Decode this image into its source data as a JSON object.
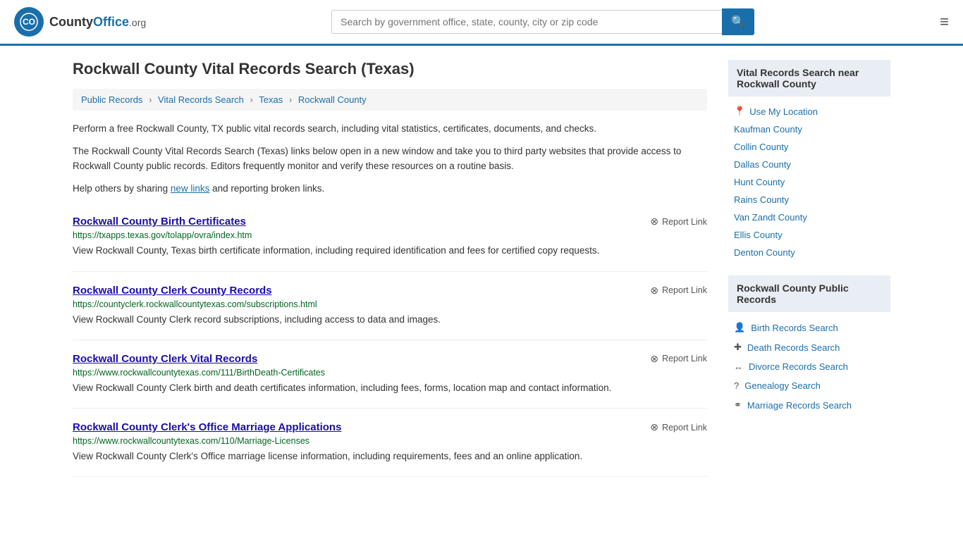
{
  "header": {
    "logo_text": "CountyOffice",
    "logo_org": ".org",
    "search_placeholder": "Search by government office, state, county, city or zip code"
  },
  "page": {
    "title": "Rockwall County Vital Records Search (Texas)"
  },
  "breadcrumb": {
    "items": [
      {
        "label": "Public Records",
        "url": "#"
      },
      {
        "label": "Vital Records Search",
        "url": "#"
      },
      {
        "label": "Texas",
        "url": "#"
      },
      {
        "label": "Rockwall County",
        "url": "#"
      }
    ]
  },
  "description": [
    {
      "text": "Perform a free Rockwall County, TX public vital records search, including vital statistics, certificates, documents, and checks."
    },
    {
      "text": "The Rockwall County Vital Records Search (Texas) links below open in a new window and take you to third party websites that provide access to Rockwall County public records. Editors frequently monitor and verify these resources on a routine basis."
    },
    {
      "text_parts": [
        "Help others by sharing ",
        "new links",
        " and reporting broken links."
      ]
    }
  ],
  "results": [
    {
      "title": "Rockwall County Birth Certificates",
      "url": "https://txapps.texas.gov/tolapp/ovra/index.htm",
      "desc": "View Rockwall County, Texas birth certificate information, including required identification and fees for certified copy requests.",
      "report_label": "Report Link"
    },
    {
      "title": "Rockwall County Clerk County Records",
      "url": "https://countyclerk.rockwallcountytexas.com/subscriptions.html",
      "desc": "View Rockwall County Clerk record subscriptions, including access to data and images.",
      "report_label": "Report Link"
    },
    {
      "title": "Rockwall County Clerk Vital Records",
      "url": "https://www.rockwallcountytexas.com/111/BirthDeath-Certificates",
      "desc": "View Rockwall County Clerk birth and death certificates information, including fees, forms, location map and contact information.",
      "report_label": "Report Link"
    },
    {
      "title": "Rockwall County Clerk's Office Marriage Applications",
      "url": "https://www.rockwallcountytexas.com/110/Marriage-Licenses",
      "desc": "View Rockwall County Clerk's Office marriage license information, including requirements, fees and an online application.",
      "report_label": "Report Link"
    }
  ],
  "sidebar": {
    "nearby_title": "Vital Records Search near Rockwall County",
    "use_my_location": "Use My Location",
    "nearby_counties": [
      {
        "label": "Kaufman County"
      },
      {
        "label": "Collin County"
      },
      {
        "label": "Dallas County"
      },
      {
        "label": "Hunt County"
      },
      {
        "label": "Rains County"
      },
      {
        "label": "Van Zandt County"
      },
      {
        "label": "Ellis County"
      },
      {
        "label": "Denton County"
      }
    ],
    "public_records_title": "Rockwall County Public Records",
    "public_records_links": [
      {
        "label": "Birth Records Search",
        "icon": "👤"
      },
      {
        "label": "Death Records Search",
        "icon": "✚"
      },
      {
        "label": "Divorce Records Search",
        "icon": "↔"
      },
      {
        "label": "Genealogy Search",
        "icon": "?"
      },
      {
        "label": "Marriage Records Search",
        "icon": "⚭"
      }
    ]
  }
}
